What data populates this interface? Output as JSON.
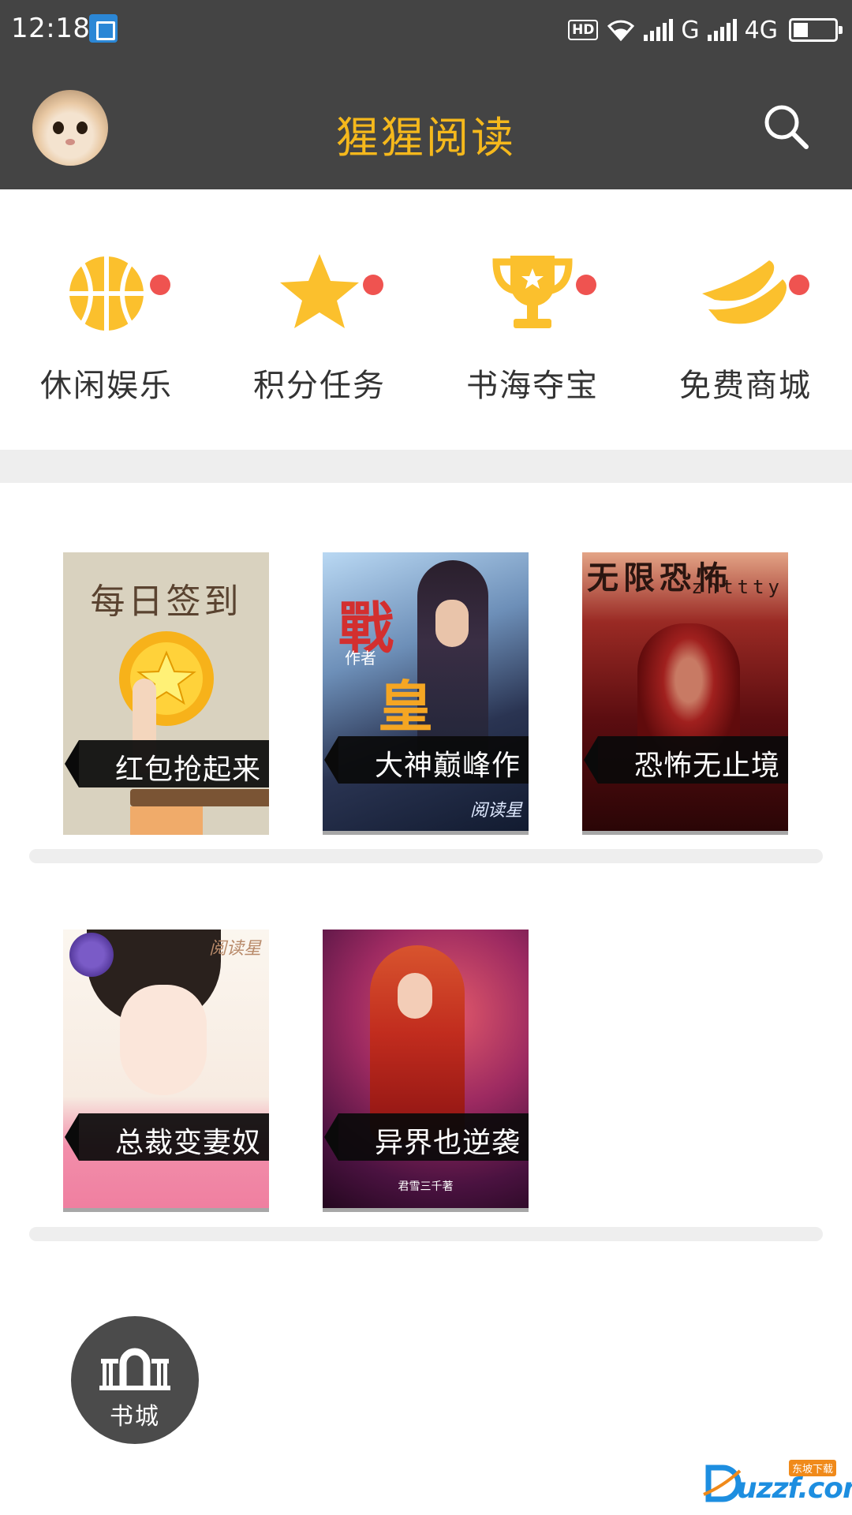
{
  "status_bar": {
    "time": "12:18",
    "hd": "HD",
    "network1": "G",
    "network2": "4G",
    "battery_level": 0.35
  },
  "app_bar": {
    "title": "猩猩阅读",
    "title_color": "#f5b81c",
    "avatar_icon": "cat-avatar",
    "search_icon": "search-icon"
  },
  "quick_entries": [
    {
      "label": "休闲娱乐",
      "icon": "basketball-icon",
      "badge": true
    },
    {
      "label": "积分任务",
      "icon": "star-icon",
      "badge": true
    },
    {
      "label": "书海夺宝",
      "icon": "trophy-icon",
      "badge": true
    },
    {
      "label": "免费商城",
      "icon": "banana-icon",
      "badge": true
    }
  ],
  "books": [
    {
      "title": "红包抢起来",
      "cover_text": "每日签到"
    },
    {
      "title": "大神巅峰作",
      "cover_text": "战皇",
      "cover_sub": "作者",
      "cover_brand": "阅读星"
    },
    {
      "title": "恐怖无止境",
      "cover_text": "无限恐怖",
      "cover_sub": "zhttty"
    },
    {
      "title": "总裁变妻奴",
      "cover_brand": "阅读星"
    },
    {
      "title": "异界也逆袭",
      "cover_sub": "君雪三千著"
    }
  ],
  "fab": {
    "label": "书城",
    "icon": "bookstore-gate-icon"
  },
  "watermark": {
    "main": "uzzf.com",
    "sub": "东坡下载"
  },
  "colors": {
    "bar_bg": "#444444",
    "accent": "#f5b81c",
    "badge": "#ef5350",
    "divider": "#eeeeee"
  }
}
